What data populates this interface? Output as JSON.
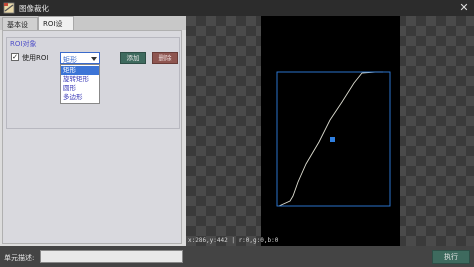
{
  "window": {
    "title": "图像裁化",
    "close_glyph": "✕"
  },
  "tabs": [
    {
      "label": "基本设置"
    },
    {
      "label": "ROI设置"
    }
  ],
  "roi_group": {
    "title": "ROI对象",
    "use_roi_label": "使用ROI",
    "use_roi_checked": true,
    "check_glyph": "✓",
    "shape_select": {
      "value": "矩形",
      "options": [
        "矩形",
        "旋转矩形",
        "圆形",
        "多边形"
      ],
      "selected_index": 0
    },
    "add_label": "添加",
    "delete_label": "删除"
  },
  "viewer": {
    "status_text": "x:286,y:442 | r:0,g:0,b:0"
  },
  "bottom": {
    "desc_label": "单元描述:",
    "desc_value": "",
    "run_label": "执行"
  },
  "colors": {
    "accent": "#3c74d6",
    "roi_rect": "#2f7fe0",
    "add_button": "#3e6a5e",
    "delete_button": "#8e5550"
  }
}
